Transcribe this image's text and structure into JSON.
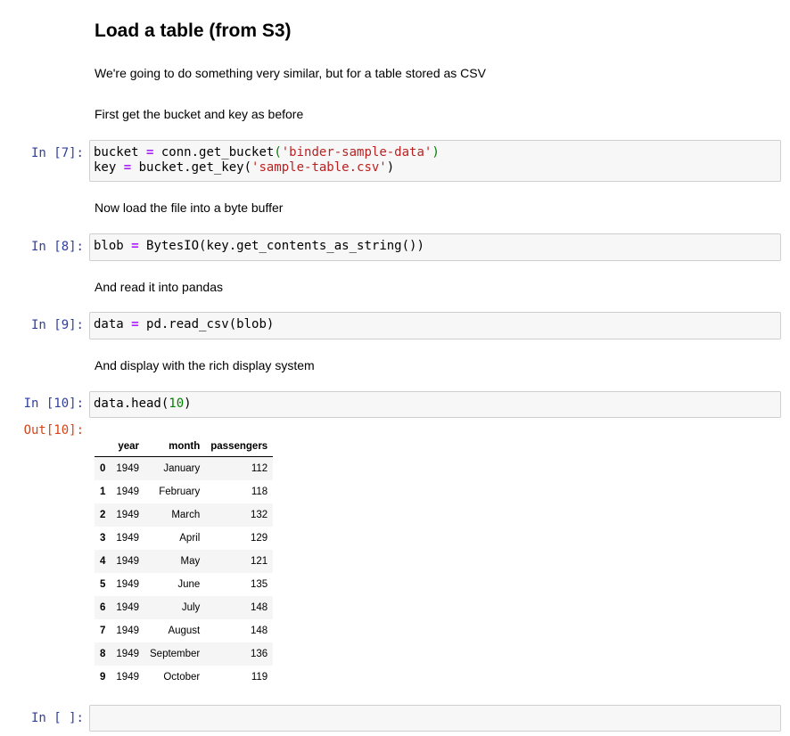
{
  "heading": "Load a table (from S3)",
  "paragraphs": {
    "intro": "We're going to do something very similar, but for a table stored as CSV",
    "bucket_key": "First get the bucket and key as before",
    "byte_buffer": "Now load the file into a byte buffer",
    "pandas": "And read it into pandas",
    "display": "And display with the rich display system"
  },
  "cells": {
    "c7": {
      "prompt": "In [7]:",
      "line1": {
        "a": "bucket ",
        "op": "=",
        "b": " conn.get_bucket",
        "p1": "(",
        "s": "'binder-sample-data'",
        "p2": ")"
      },
      "line2": {
        "a": "key ",
        "op": "=",
        "b": " bucket.get_key(",
        "s": "'sample-table.csv'",
        "p2": ")"
      }
    },
    "c8": {
      "prompt": "In [8]:",
      "a": "blob ",
      "op": "=",
      "b": " BytesIO(key.get_contents_as_string())"
    },
    "c9": {
      "prompt": "In [9]:",
      "a": "data ",
      "op": "=",
      "b": " pd.read_csv(blob)"
    },
    "c10": {
      "prompt": "In [10]:",
      "a": "data.head(",
      "num": "10",
      "b": ")",
      "out_prompt": "Out[10]:"
    },
    "empty": {
      "prompt": "In [ ]:"
    }
  },
  "table": {
    "columns": [
      "",
      "year",
      "month",
      "passengers"
    ],
    "rows": [
      [
        "0",
        "1949",
        "January",
        "112"
      ],
      [
        "1",
        "1949",
        "February",
        "118"
      ],
      [
        "2",
        "1949",
        "March",
        "132"
      ],
      [
        "3",
        "1949",
        "April",
        "129"
      ],
      [
        "4",
        "1949",
        "May",
        "121"
      ],
      [
        "5",
        "1949",
        "June",
        "135"
      ],
      [
        "6",
        "1949",
        "July",
        "148"
      ],
      [
        "7",
        "1949",
        "August",
        "148"
      ],
      [
        "8",
        "1949",
        "September",
        "136"
      ],
      [
        "9",
        "1949",
        "October",
        "119"
      ]
    ]
  }
}
